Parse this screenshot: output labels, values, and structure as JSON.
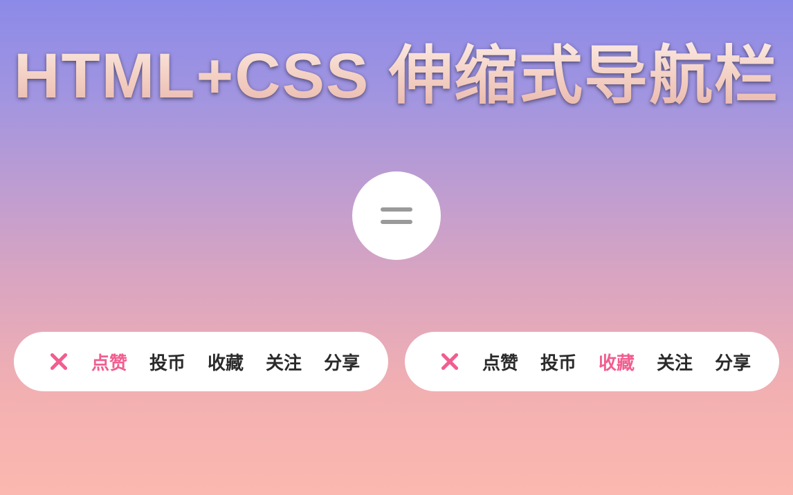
{
  "title": "HTML+CSS 伸缩式导航栏",
  "nav_left": {
    "active_index": 0,
    "items": [
      {
        "label": "点赞"
      },
      {
        "label": "投币"
      },
      {
        "label": "收藏"
      },
      {
        "label": "关注"
      },
      {
        "label": "分享"
      }
    ]
  },
  "nav_right": {
    "active_index": 2,
    "items": [
      {
        "label": "点赞"
      },
      {
        "label": "投币"
      },
      {
        "label": "收藏"
      },
      {
        "label": "关注"
      },
      {
        "label": "分享"
      }
    ]
  },
  "colors": {
    "accent": "#f25d8e",
    "text": "#2a2a2a"
  }
}
